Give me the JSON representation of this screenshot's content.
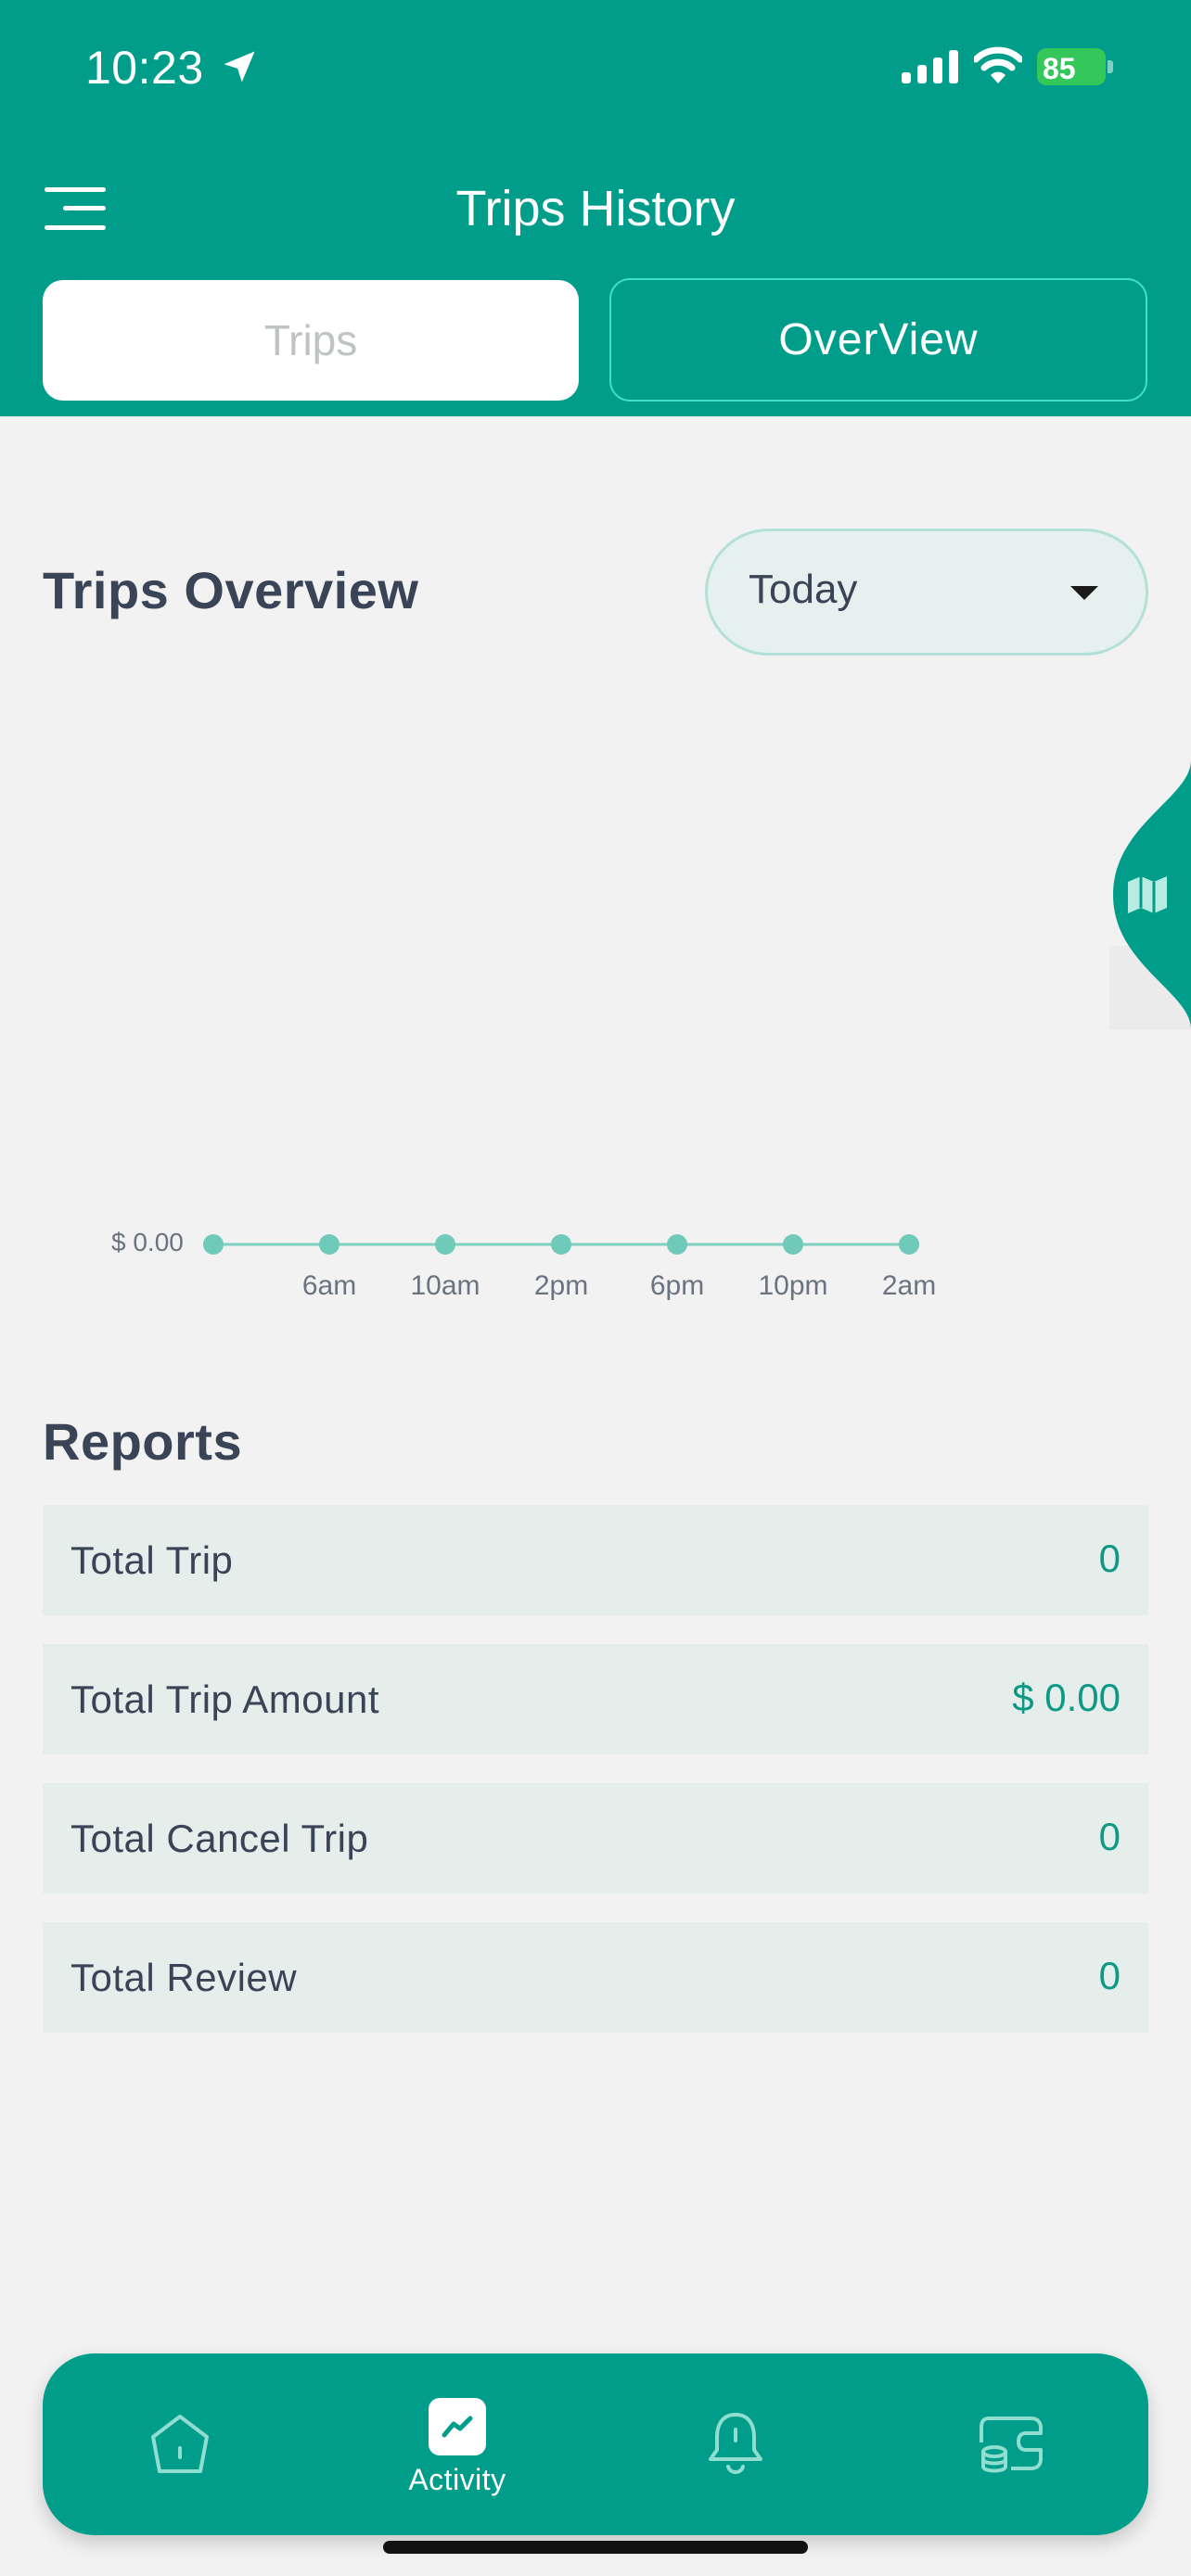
{
  "status_bar": {
    "time": "10:23",
    "battery_percent": "85",
    "icons": [
      "location-arrow-icon",
      "signal-icon",
      "wifi-icon",
      "battery-charging-icon"
    ]
  },
  "header": {
    "title": "Trips History",
    "menu_icon": "menu-icon"
  },
  "segments": {
    "trips_label": "Trips",
    "overview_label": "OverView",
    "active": "overview"
  },
  "overview": {
    "title": "Trips Overview",
    "period_selected": "Today"
  },
  "chart_data": {
    "type": "line",
    "x": [
      "",
      "6am",
      "10am",
      "2pm",
      "6pm",
      "10pm",
      "2am"
    ],
    "values": [
      0,
      0,
      0,
      0,
      0,
      0,
      0
    ],
    "y_tick_label": "$ 0.00",
    "title": "",
    "xlabel": "",
    "ylabel": "",
    "grid": false
  },
  "reports": {
    "title": "Reports",
    "rows": [
      {
        "label": "Total Trip",
        "value": "0"
      },
      {
        "label": "Total Trip Amount",
        "value": "$ 0.00"
      },
      {
        "label": "Total Cancel Trip",
        "value": "0"
      },
      {
        "label": "Total Review",
        "value": "0"
      }
    ]
  },
  "bottom_nav": {
    "items": [
      {
        "icon": "home-icon",
        "label": ""
      },
      {
        "icon": "activity-icon",
        "label": "Activity"
      },
      {
        "icon": "bell-icon",
        "label": ""
      },
      {
        "icon": "wallet-icon",
        "label": ""
      }
    ],
    "active_index": 1
  },
  "colors": {
    "brand": "#009e8a",
    "accent_text": "#0e9985",
    "chart_line": "#7fcfc0",
    "chart_point": "#6fcab9"
  }
}
